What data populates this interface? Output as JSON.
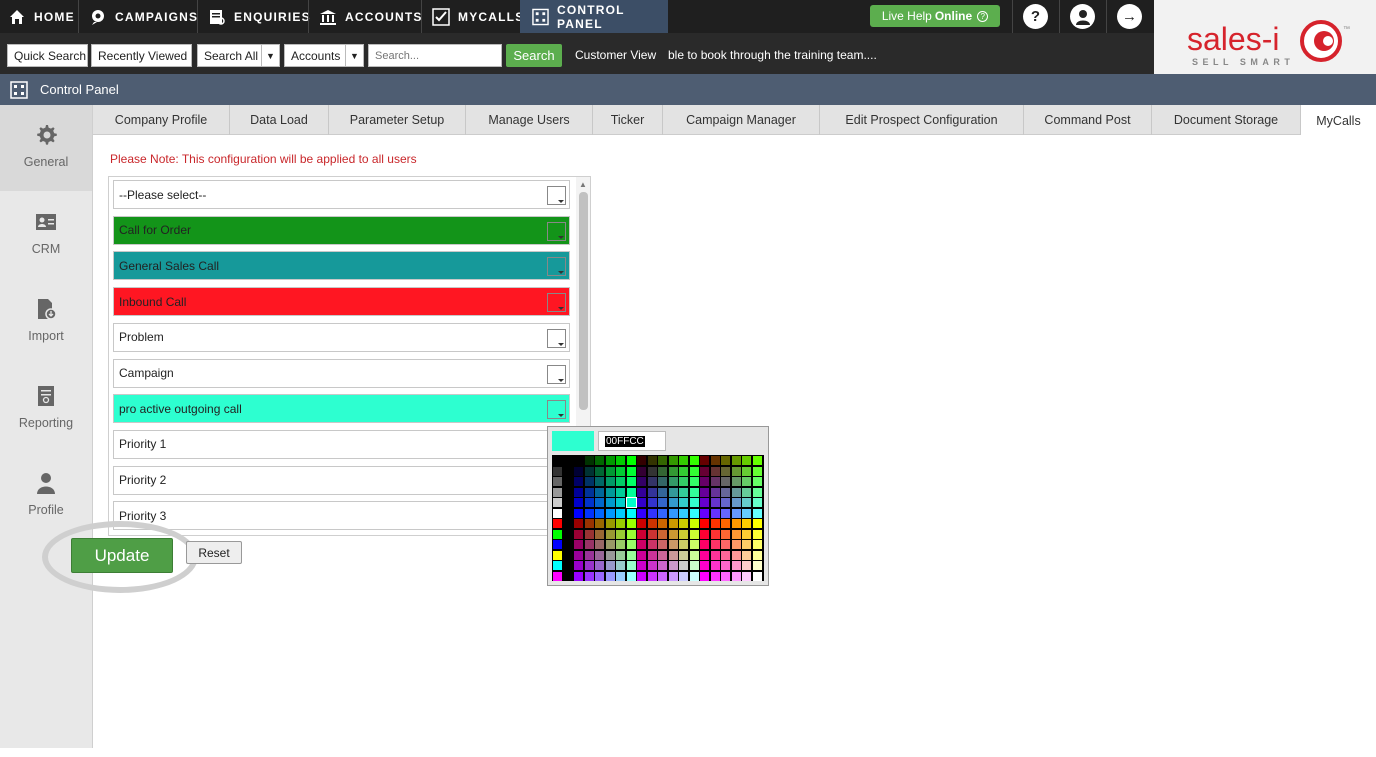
{
  "nav": {
    "items": [
      {
        "label": "HOME",
        "icon": "home-icon"
      },
      {
        "label": "CAMPAIGNS",
        "icon": "campaigns-icon"
      },
      {
        "label": "ENQUIRIES",
        "icon": "enquiries-icon"
      },
      {
        "label": "ACCOUNTS",
        "icon": "accounts-icon"
      },
      {
        "label": "MYCALLS",
        "icon": "mycalls-icon"
      },
      {
        "label": "CONTROL PANEL",
        "icon": "control-panel-icon"
      }
    ],
    "active": "CONTROL PANEL",
    "live_help_prefix": "Live Help",
    "live_help_status": "Online",
    "help_symbol": "?",
    "logout_symbol": "→"
  },
  "searchbar": {
    "quick_search": "Quick Search",
    "recently_viewed": "Recently Viewed",
    "search_all": "Search All",
    "accounts": "Accounts",
    "placeholder": "Search...",
    "search_button": "Search",
    "customer_view": "Customer View",
    "ticker": "ble to book through the training team...."
  },
  "logo": {
    "brand": "sales-i",
    "tagline": "SELL SMART",
    "tm": "™"
  },
  "header": {
    "title": "Control Panel"
  },
  "sidebar": {
    "items": [
      {
        "label": "General",
        "icon": "gear-icon"
      },
      {
        "label": "CRM",
        "icon": "crm-card-icon"
      },
      {
        "label": "Import",
        "icon": "import-icon"
      },
      {
        "label": "Reporting",
        "icon": "reporting-icon"
      },
      {
        "label": "Profile",
        "icon": "person-icon"
      }
    ]
  },
  "tabs": [
    "Company Profile",
    "Data Load",
    "Parameter Setup",
    "Manage Users",
    "Ticker",
    "Campaign Manager",
    "Edit Prospect Configuration",
    "Command Post",
    "Document Storage",
    "MyCalls"
  ],
  "active_tab": "MyCalls",
  "content": {
    "note": "Please Note: This configuration will be applied to all users",
    "rows": [
      {
        "label": "--Please select--",
        "color": "#ffffff"
      },
      {
        "label": "Call for Order",
        "color": "#139419"
      },
      {
        "label": "General Sales Call",
        "color": "#16999a"
      },
      {
        "label": "Inbound Call",
        "color": "#ff1622"
      },
      {
        "label": "Problem",
        "color": "#ffffff"
      },
      {
        "label": "Campaign",
        "color": "#ffffff"
      },
      {
        "label": "pro active outgoing call",
        "color": "#2dffd0"
      },
      {
        "label": "Priority 1",
        "color": "#ffffff"
      },
      {
        "label": "Priority 2",
        "color": "#ffffff"
      },
      {
        "label": "Priority 3",
        "color": "#ffffff"
      }
    ],
    "update_button": "Update",
    "reset_button": "Reset"
  },
  "picker": {
    "hex": "00FFCC",
    "preview_color": "#2dffd0"
  }
}
